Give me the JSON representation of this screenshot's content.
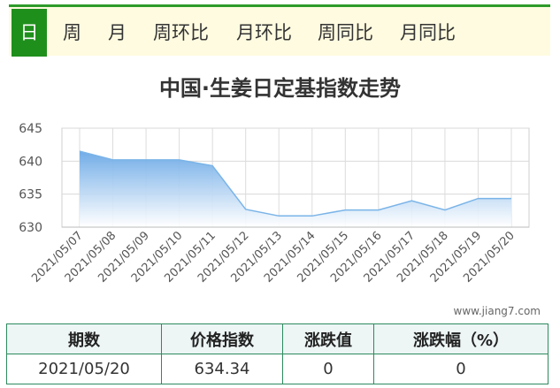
{
  "tabs": [
    {
      "label": "日",
      "active": true
    },
    {
      "label": "周"
    },
    {
      "label": "月"
    },
    {
      "label": "周环比"
    },
    {
      "label": "月环比"
    },
    {
      "label": "周同比"
    },
    {
      "label": "月同比"
    }
  ],
  "title": "中国·生姜日定基指数走势",
  "watermark": "www.jiang7.com",
  "colors": {
    "accent_green": "#1f8f1c",
    "line_blue": "#7ab4e8",
    "table_border": "#2d8a5e"
  },
  "chart_data": {
    "type": "area",
    "title": "中国·生姜日定基指数走势",
    "xlabel": "",
    "ylabel": "",
    "x": [
      "2021/05/07",
      "2021/05/08",
      "2021/05/09",
      "2021/05/10",
      "2021/05/11",
      "2021/05/12",
      "2021/05/13",
      "2021/05/14",
      "2021/05/15",
      "2021/05/16",
      "2021/05/17",
      "2021/05/18",
      "2021/05/19",
      "2021/05/20"
    ],
    "series": [
      {
        "values": [
          641.5,
          640.2,
          640.2,
          640.2,
          639.3,
          632.7,
          631.7,
          631.7,
          632.6,
          632.6,
          634.0,
          632.6,
          634.34,
          634.34
        ]
      }
    ],
    "ylim": [
      630,
      645
    ],
    "yticks": [
      630,
      635,
      640,
      645
    ],
    "grid": true
  },
  "table": {
    "headers": [
      "期数",
      "价格指数",
      "涨跌值",
      "涨跌幅（%）"
    ],
    "rows": [
      [
        "2021/05/20",
        "634.34",
        "0",
        "0"
      ]
    ]
  }
}
